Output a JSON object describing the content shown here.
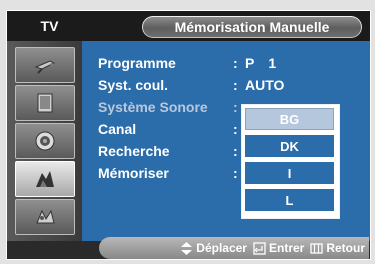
{
  "header": {
    "tv_label": "TV",
    "title": "Mémorisation Manuelle"
  },
  "sidebar": {
    "items": [
      {
        "icon": "antenna-icon"
      },
      {
        "icon": "picture-icon"
      },
      {
        "icon": "speaker-icon"
      },
      {
        "icon": "channel-icon",
        "active": true
      },
      {
        "icon": "setup-icon"
      }
    ]
  },
  "menu": {
    "rows": [
      {
        "label": "Programme",
        "value_p": "P",
        "value": "1"
      },
      {
        "label": "Syst. coul.",
        "value": "AUTO"
      },
      {
        "label": "Système Sonore",
        "value": ""
      },
      {
        "label": "Canal",
        "value": ""
      },
      {
        "label": "Recherche",
        "value": ""
      },
      {
        "label": "Mémoriser",
        "value": ""
      }
    ],
    "separator": ":"
  },
  "dropdown": {
    "options": [
      "BG",
      "DK",
      "I",
      "L"
    ],
    "selected": "BG"
  },
  "footer": {
    "move": "Déplacer",
    "enter": "Entrer",
    "back": "Retour"
  },
  "colors": {
    "background": "#2b6caa",
    "highlight": "#b4c7dc"
  }
}
